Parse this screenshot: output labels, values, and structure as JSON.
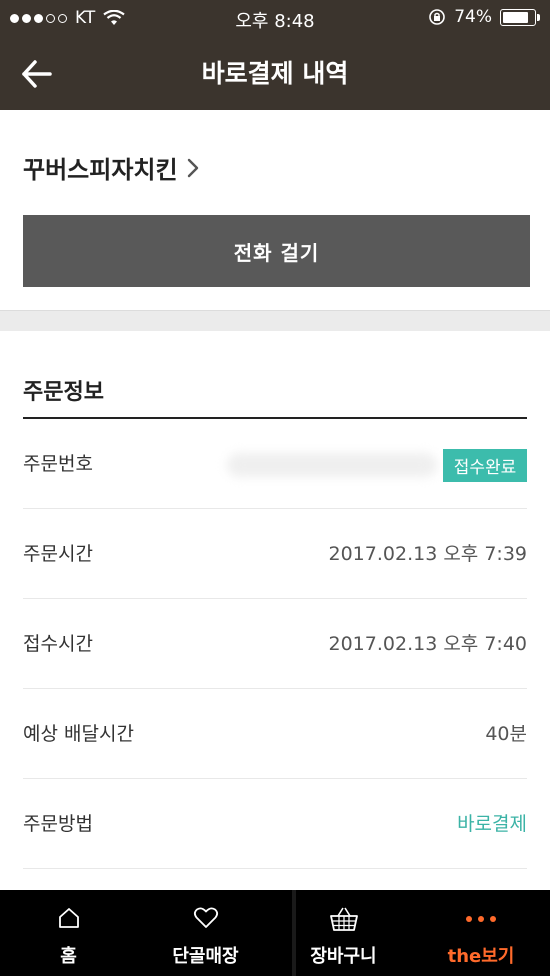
{
  "status_bar": {
    "carrier": "KT",
    "time": "오후 8:48",
    "battery": "74%",
    "battery_level": 0.74
  },
  "header": {
    "title": "바로결제 내역",
    "back_icon": "arrow-left-icon"
  },
  "store": {
    "name": "꾸버스피자치킨",
    "call_button": "전화 걸기"
  },
  "order_info": {
    "title": "주문정보",
    "rows": [
      {
        "label": "주문번호",
        "value": "",
        "badge": "접수완료"
      },
      {
        "label": "주문시간",
        "value": "2017.02.13 오후 7:39"
      },
      {
        "label": "접수시간",
        "value": "2017.02.13 오후 7:40"
      },
      {
        "label": "예상 배달시간",
        "value": "40분"
      },
      {
        "label": "주문방법",
        "value": "바로결제"
      }
    ]
  },
  "tabbar": {
    "items": [
      {
        "label": "홈",
        "icon": "home-icon"
      },
      {
        "label": "단골매장",
        "icon": "heart-icon"
      },
      {
        "label": "장바구니",
        "icon": "basket-icon"
      },
      {
        "label": "the보기",
        "icon": "more-dots-icon",
        "active": true
      }
    ]
  },
  "colors": {
    "header_bg": "#3b342d",
    "call_button_bg": "#595959",
    "accent_teal": "#3cbcac",
    "tab_active": "#ff6a2b"
  }
}
